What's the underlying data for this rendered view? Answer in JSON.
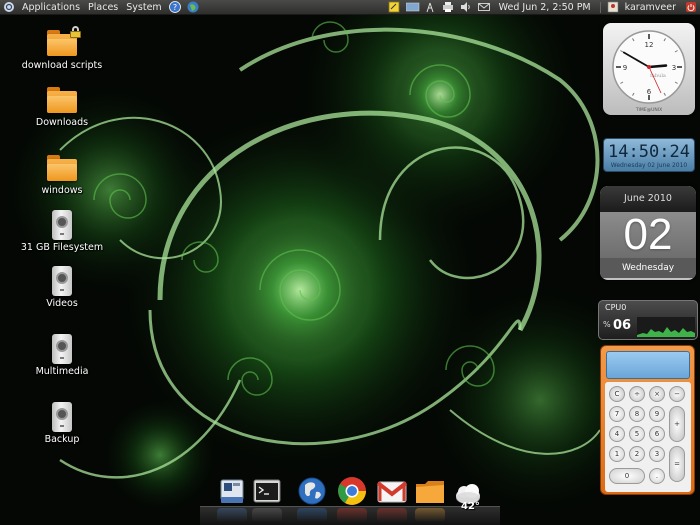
{
  "top_panel": {
    "menus": [
      "Applications",
      "Places",
      "System"
    ],
    "clock": "Wed Jun  2,  2:50 PM",
    "username": "karamveer"
  },
  "desktop_icons": [
    {
      "label": "download scripts",
      "icon": "folder-locked-icon"
    },
    {
      "label": "Downloads",
      "icon": "folder-icon"
    },
    {
      "label": "windows",
      "icon": "folder-icon"
    },
    {
      "label": "31 GB Filesystem",
      "icon": "drive-icon"
    },
    {
      "label": "Videos",
      "icon": "drive-icon"
    },
    {
      "label": "Multimedia",
      "icon": "drive-icon"
    },
    {
      "label": "Backup",
      "icon": "drive-icon"
    }
  ],
  "widgets": {
    "analog_clock": {
      "brand": "fabula",
      "footer": "TIME@UNIX",
      "hour": 2,
      "minute": 50
    },
    "digital_clock": {
      "time": "14:50:24",
      "date": "Wednesday 02 June 2010"
    },
    "calendar": {
      "month_year": "June 2010",
      "day": "02",
      "weekday": "Wednesday"
    },
    "cpu": {
      "label": "CPU0",
      "percent_symbol": "%",
      "value": "06"
    },
    "calculator": {
      "keys": [
        "C",
        "÷",
        "×",
        "−",
        "7",
        "8",
        "9",
        "+",
        "4",
        "5",
        "6",
        "1",
        "2",
        "3",
        "=",
        "0",
        "."
      ]
    }
  },
  "dock": {
    "items": [
      "display-settings-icon",
      "terminal-icon",
      "web-browser-globe-icon",
      "chrome-icon",
      "gmail-icon",
      "home-folder-icon",
      "weather-icon"
    ],
    "weather_temp": "42°"
  },
  "colors": {
    "panel": "#3a3a38",
    "wallpaper_green": "#3fae3a",
    "calculator_orange": "#ea7e2c"
  }
}
